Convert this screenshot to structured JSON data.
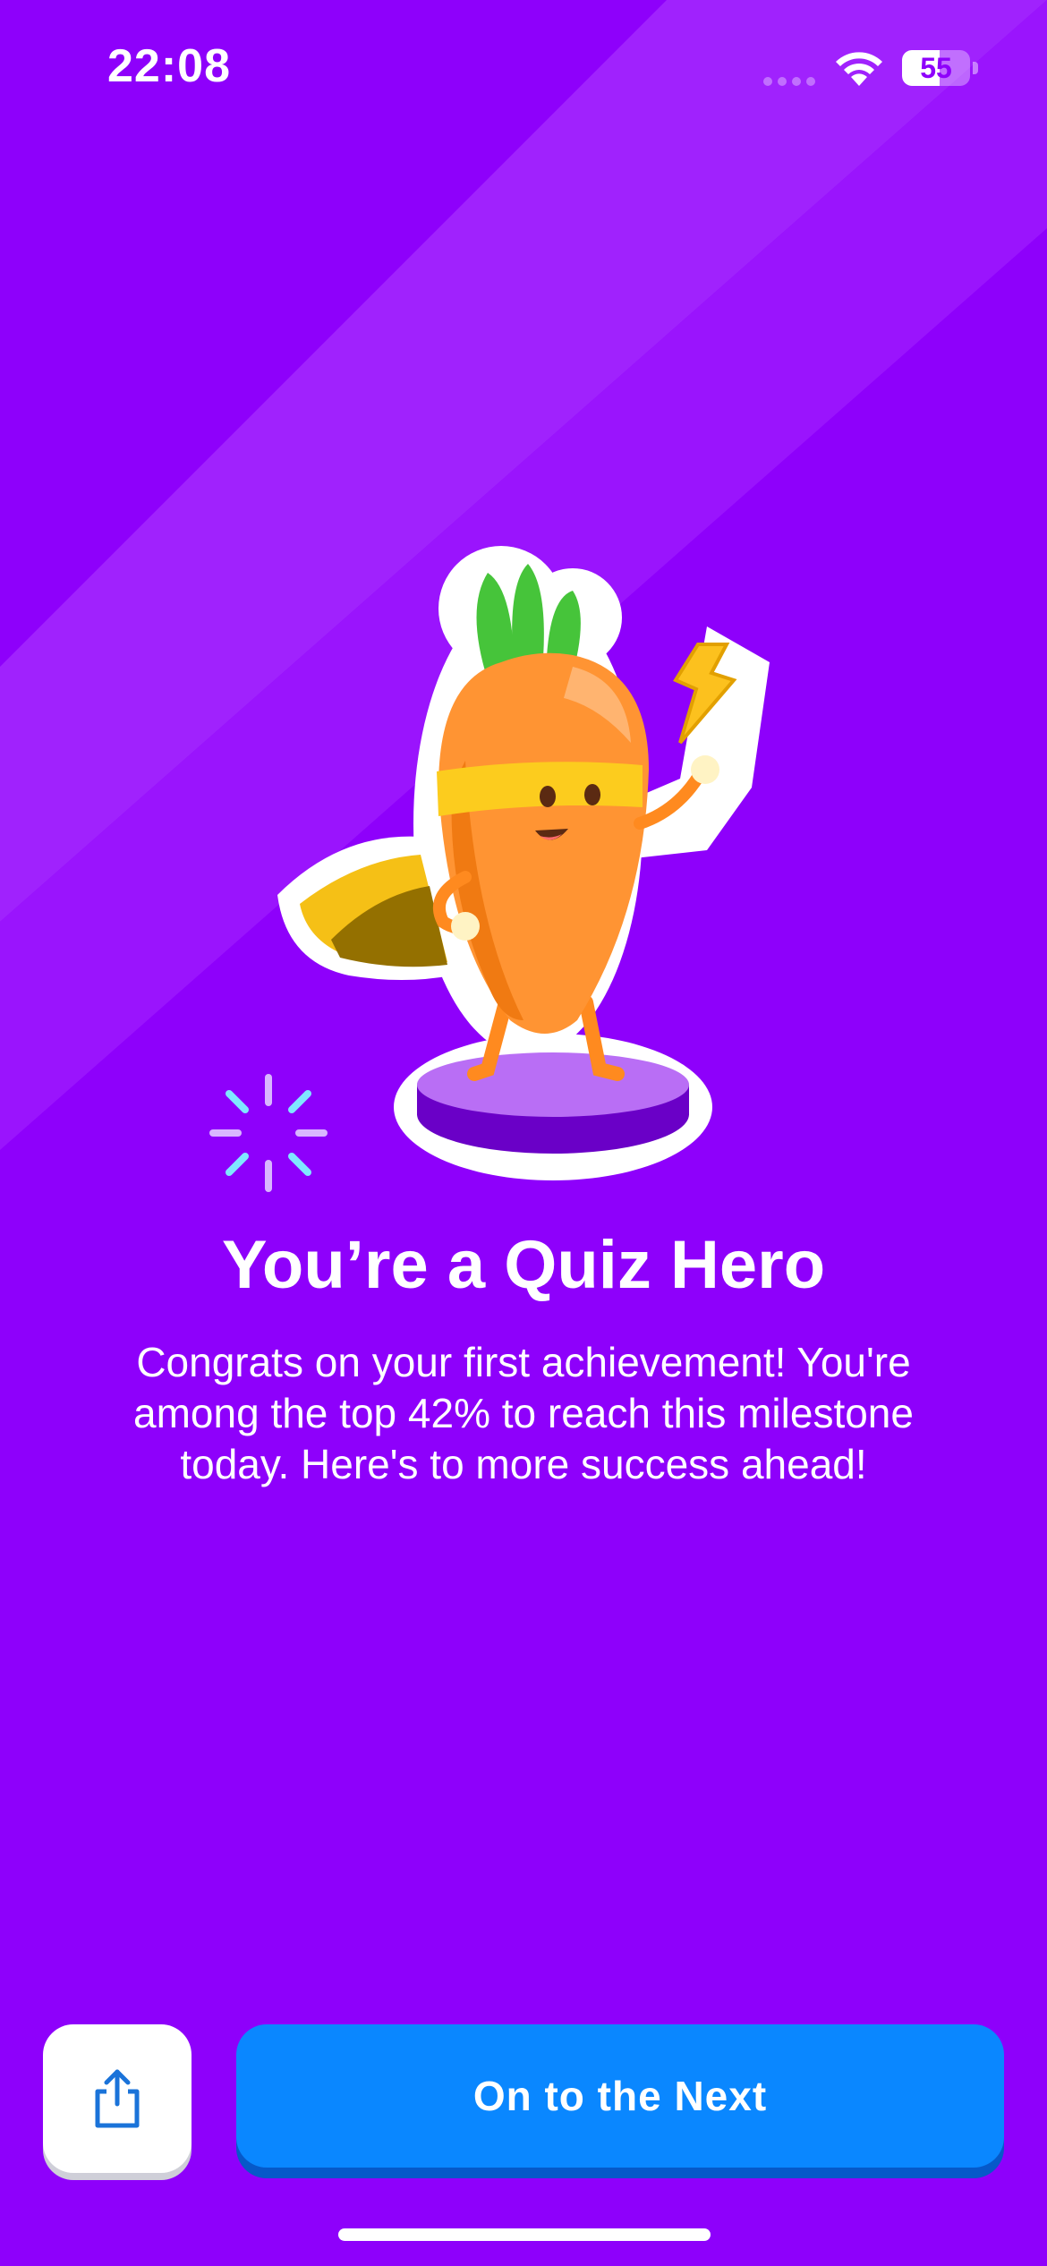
{
  "status_bar": {
    "time": "22:08",
    "battery_level": 55,
    "battery_text": "55"
  },
  "achievement": {
    "title": "You’re a Quiz Hero",
    "description": "Congrats on your first achievement! You're among the top 42% to reach this milestone today. Here's to more success ahead!",
    "illustration": "superhero-carrot-on-pedestal"
  },
  "actions": {
    "share_icon": "share-icon",
    "next_label": "On to the Next"
  },
  "colors": {
    "background": "#8e00fb",
    "primary_button": "#0a87ff",
    "carrot": "#ff9433",
    "cape": "#f5c016"
  }
}
